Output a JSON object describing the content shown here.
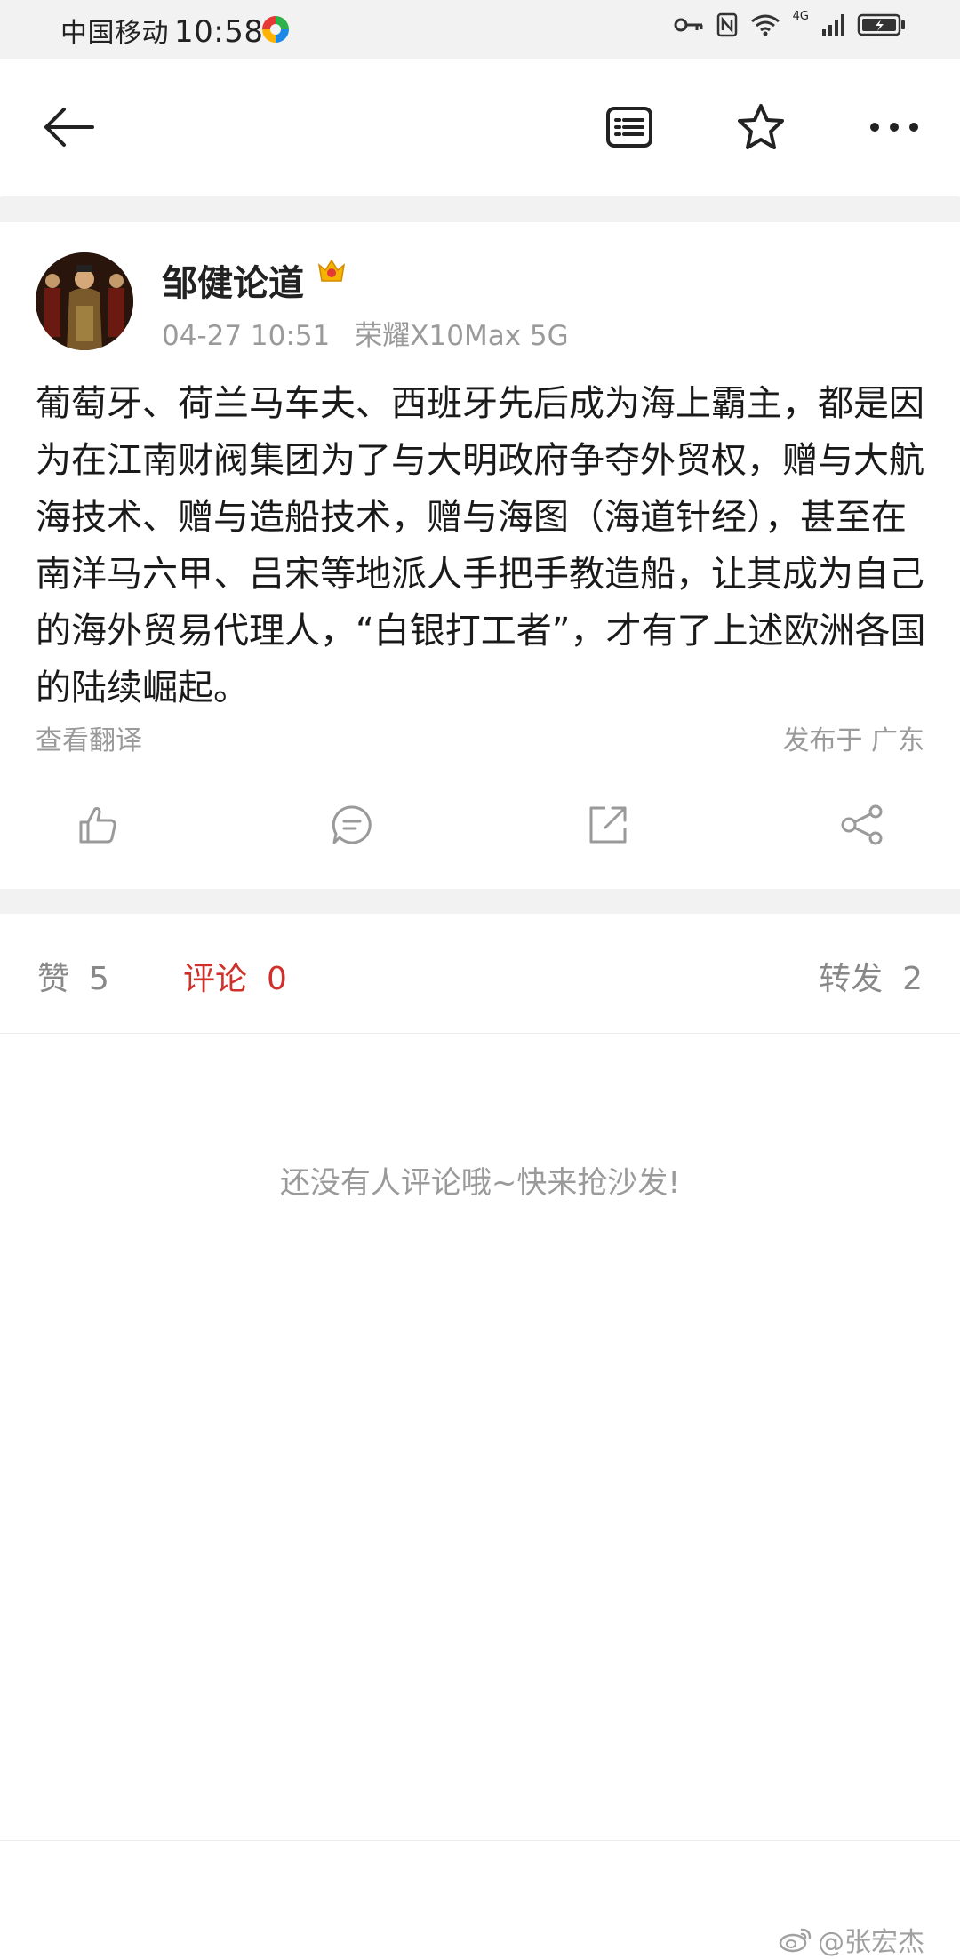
{
  "status_bar": {
    "carrier": "中国移动",
    "time": "10:58",
    "network": "4G"
  },
  "top_bar": {
    "icons": [
      "back-arrow-icon",
      "article-icon",
      "star-icon",
      "more-icon"
    ]
  },
  "post": {
    "author": "邹健论道",
    "badge_icon": "crown-badge-icon",
    "date": "04-27 10:51",
    "device": "荣耀X10Max 5G",
    "content": "葡萄牙、荷兰马车夫、西班牙先后成为海上霸主，都是因为在江南财阀集团为了与大明政府争夺外贸权，赠与大航海技术、赠与造船技术，赠与海图（海道针经），甚至在南洋马六甲、吕宋等地派人手把手教造船，让其成为自己的海外贸易代理人，“白银打工者”，才有了上述欧洲各国的陆续崛起。",
    "translate_label": "查看翻译",
    "location": "发布于 广东"
  },
  "stats": {
    "likes_label": "赞",
    "likes_count": "5",
    "comments_label": "评论",
    "comments_count": "0",
    "reposts_label": "转发",
    "reposts_count": "2"
  },
  "empty_state": "还没有人评论哦~快来抢沙发!",
  "watermark": "@张宏杰",
  "colors": {
    "accent_red": "#d0302a",
    "muted_text": "#9a9a9a",
    "divider_bg": "#f2f2f2"
  }
}
